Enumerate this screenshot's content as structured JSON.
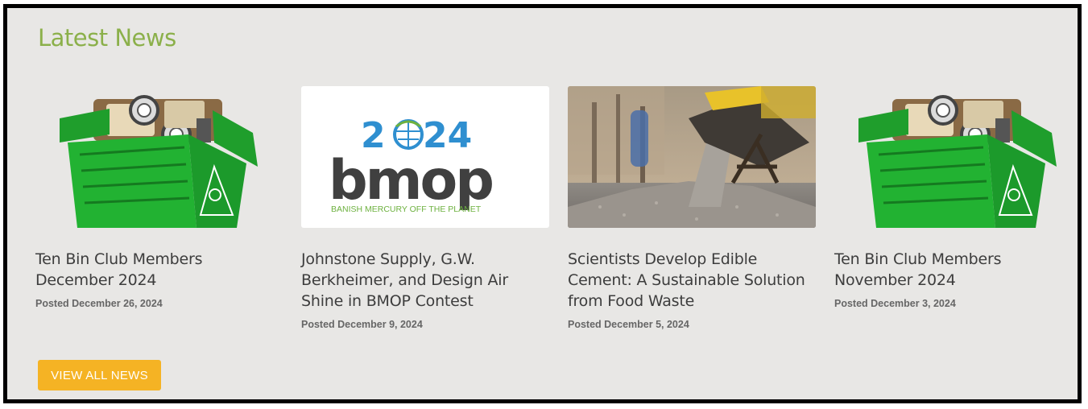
{
  "section": {
    "title": "Latest News",
    "view_all_label": "VIEW ALL NEWS"
  },
  "articles": [
    {
      "title": "Ten Bin Club Members December 2024",
      "date": "Posted December 26, 2024",
      "image": "green-recycling-bin-icon"
    },
    {
      "title": "Johnstone Supply, G.W. Berkheimer, and Design Air Shine in BMOP Contest",
      "date": "Posted December 9, 2024",
      "image": "bmop-logo",
      "logo_text": {
        "year_left": "2",
        "year_right": "24",
        "wordmark": "bmop",
        "tagline": "BANISH MERCURY OFF THE PLANET"
      }
    },
    {
      "title": "Scientists Develop Edible Cement: A Sustainable Solution from Food Waste",
      "date": "Posted December 5, 2024",
      "image": "cement-pour-photo"
    },
    {
      "title": "Ten Bin Club Members November 2024",
      "date": "Posted December 3, 2024",
      "image": "green-recycling-bin-icon"
    }
  ],
  "colors": {
    "heading": "#8bb04a",
    "button": "#f5b324",
    "background": "#e8e7e5",
    "bin_green": "#22b232",
    "bmop_blue": "#2f8fd0",
    "bmop_green": "#6db13f",
    "bmop_dark": "#404040"
  }
}
